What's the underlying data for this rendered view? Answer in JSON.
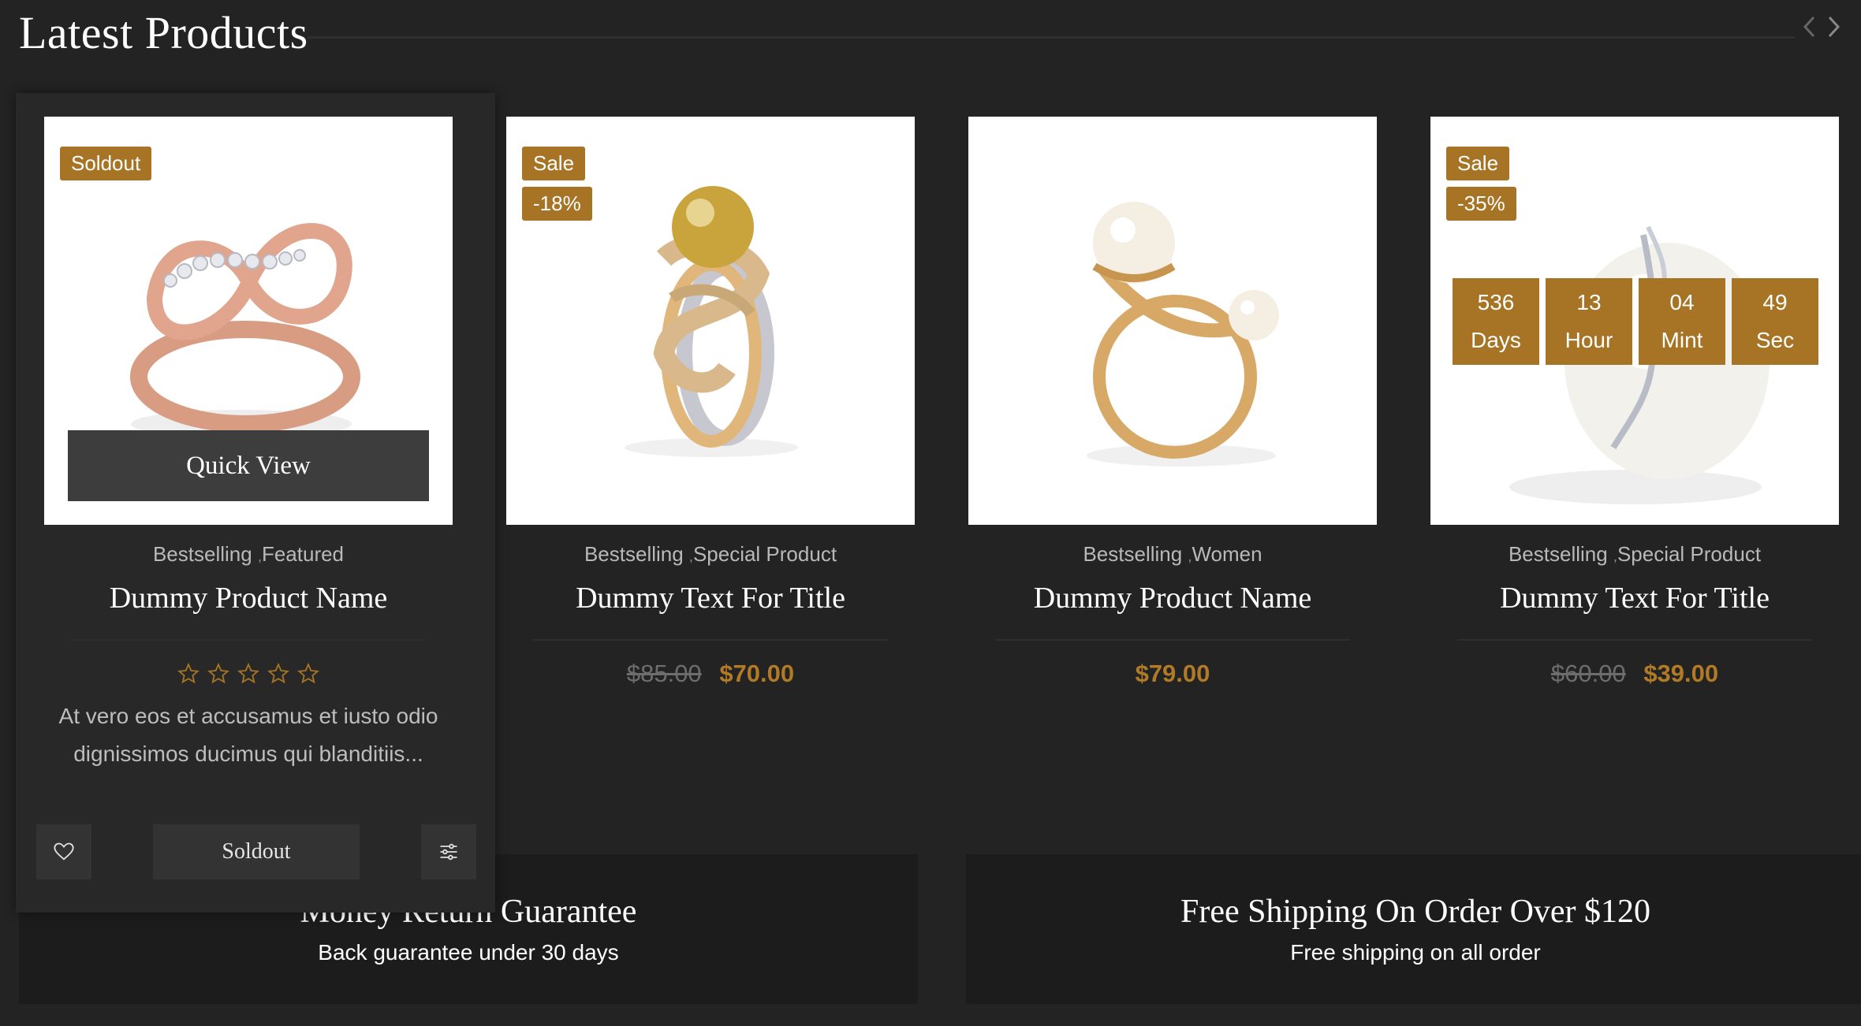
{
  "section": {
    "title": "Latest Products",
    "prev_icon": "chevron-left-icon",
    "next_icon": "chevron-right-icon"
  },
  "colors": {
    "accent": "#a67424",
    "price": "#b17a26",
    "background": "#232323"
  },
  "products": [
    {
      "badges": [
        "Soldout"
      ],
      "quick_view": "Quick View",
      "cat1": "Bestselling",
      "cat_sep": ",",
      "cat2": "Featured",
      "name": "Dummy Product Name",
      "rating": 0,
      "rating_max": 5,
      "description_line1": "At vero eos et accusamus et iusto odio",
      "description_line2": "dignissimos ducimus qui blanditiis...",
      "soldout_button": "Soldout"
    },
    {
      "badges": [
        "Sale",
        "-18%"
      ],
      "cat1": "Bestselling",
      "cat_sep": ",",
      "cat2": "Special Product",
      "name": "Dummy Text For Title",
      "old_price": "$85.00",
      "price": "$70.00"
    },
    {
      "cat1": "Bestselling",
      "cat_sep": ",",
      "cat2": "Women",
      "name": "Dummy Product Name",
      "price": "$79.00"
    },
    {
      "badges": [
        "Sale",
        "-35%"
      ],
      "countdown": [
        {
          "value": "536",
          "unit": "Days"
        },
        {
          "value": "13",
          "unit": "Hour"
        },
        {
          "value": "04",
          "unit": "Mint"
        },
        {
          "value": "49",
          "unit": "Sec"
        }
      ],
      "cat1": "Bestselling",
      "cat_sep": ",",
      "cat2": "Special Product",
      "name": "Dummy Text For Title",
      "old_price": "$60.00",
      "price": "$39.00"
    }
  ],
  "info": [
    {
      "title": "Money Return Guarantee",
      "subtitle": "Back guarantee under 30 days"
    },
    {
      "title": "Free Shipping On Order Over $120",
      "subtitle": "Free shipping on all order"
    }
  ]
}
